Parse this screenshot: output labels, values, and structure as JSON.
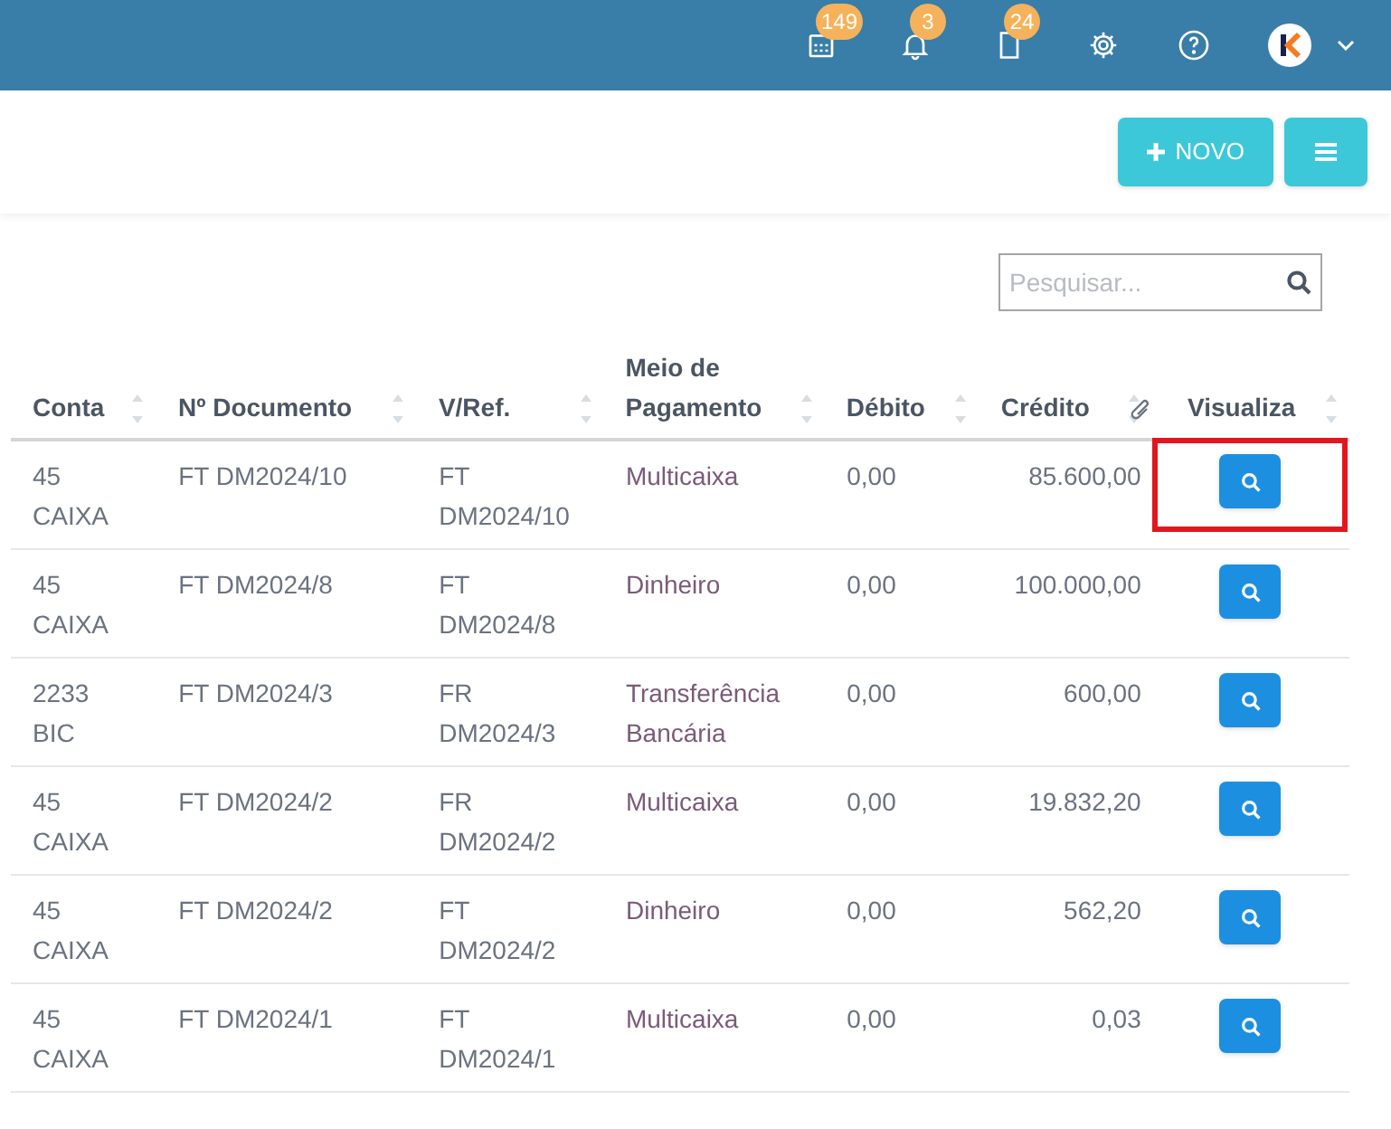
{
  "header": {
    "badges": [
      {
        "kind": "calendar",
        "count": "149"
      },
      {
        "kind": "bell",
        "count": "3"
      },
      {
        "kind": "document",
        "count": "24"
      }
    ]
  },
  "toolbar": {
    "new_button": "NOVO"
  },
  "search": {
    "placeholder": "Pesquisar..."
  },
  "table": {
    "columns": [
      "Conta",
      "Nº Documento",
      "V/Ref.",
      "Meio de Pagamento",
      "Débito",
      "Crédito",
      "Visualiza"
    ],
    "rows": [
      {
        "conta": "45 CAIXA",
        "documento": "FT DM2024/10",
        "ref": "FT DM2024/10",
        "meio": "Multicaixa",
        "debito": "0,00",
        "credito": "85.600,00",
        "highlighted": true
      },
      {
        "conta": "45 CAIXA",
        "documento": "FT DM2024/8",
        "ref": "FT DM2024/8",
        "meio": "Dinheiro",
        "debito": "0,00",
        "credito": "100.000,00",
        "highlighted": false
      },
      {
        "conta": "2233 BIC",
        "documento": "FT DM2024/3",
        "ref": "FR DM2024/3",
        "meio": "Transferência Bancária",
        "debito": "0,00",
        "credito": "600,00",
        "highlighted": false
      },
      {
        "conta": "45 CAIXA",
        "documento": "FT DM2024/2",
        "ref": "FR DM2024/2",
        "meio": "Multicaixa",
        "debito": "0,00",
        "credito": "19.832,20",
        "highlighted": false
      },
      {
        "conta": "45 CAIXA",
        "documento": "FT DM2024/2",
        "ref": "FT DM2024/2",
        "meio": "Dinheiro",
        "debito": "0,00",
        "credito": "562,20",
        "highlighted": false
      },
      {
        "conta": "45 CAIXA",
        "documento": "FT DM2024/1",
        "ref": "FT DM2024/1",
        "meio": "Multicaixa",
        "debito": "0,00",
        "credito": "0,03",
        "highlighted": false
      }
    ]
  }
}
